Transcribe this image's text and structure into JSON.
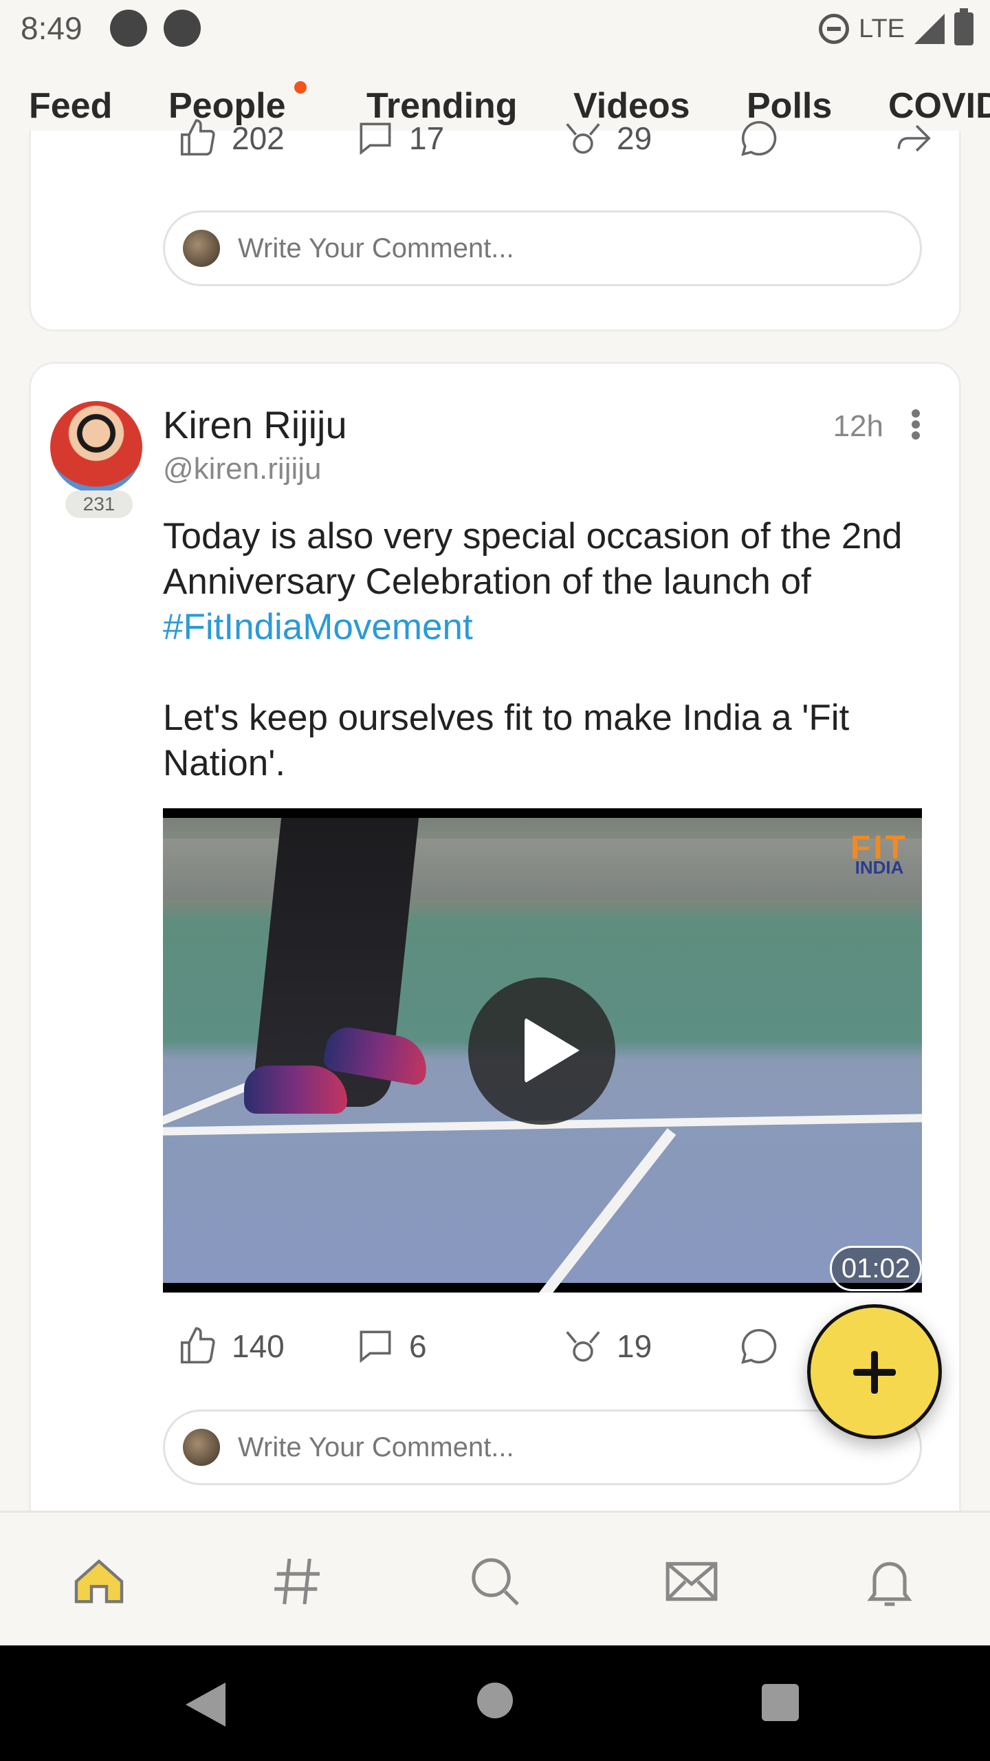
{
  "status_bar": {
    "time": "8:49",
    "network": "LTE"
  },
  "tabs": [
    {
      "label": "Feed",
      "active": true
    },
    {
      "label": "People",
      "has_notification_dot": true
    },
    {
      "label": "Trending"
    },
    {
      "label": "Videos"
    },
    {
      "label": "Polls"
    },
    {
      "label": "COVID"
    }
  ],
  "prev_post": {
    "likes": "202",
    "comments": "17",
    "shares": "29",
    "comment_placeholder": "Write Your Comment..."
  },
  "post": {
    "author_name": "Kiren Rijiju",
    "author_handle": "@kiren.rijiju",
    "avatar_badge": "231",
    "time": "12h",
    "text_line1": "Today is also very special occasion of the 2nd Anniversary Celebration of the launch of ",
    "hashtag": "#FitIndiaMovement",
    "text_line2": "Let's keep ourselves fit to make India a 'Fit Nation'.",
    "video": {
      "duration": "01:02",
      "logo_top": "FIT",
      "logo_bottom": "INDIA"
    },
    "likes": "140",
    "comments": "6",
    "shares": "19",
    "comment_placeholder": "Write Your Comment..."
  },
  "colors": {
    "accent": "#f3d24a",
    "link": "#2a9ad8",
    "notification": "#f2541b"
  },
  "bottom_nav": [
    "home-icon",
    "hashtag-icon",
    "search-icon",
    "mail-icon",
    "bell-icon"
  ]
}
